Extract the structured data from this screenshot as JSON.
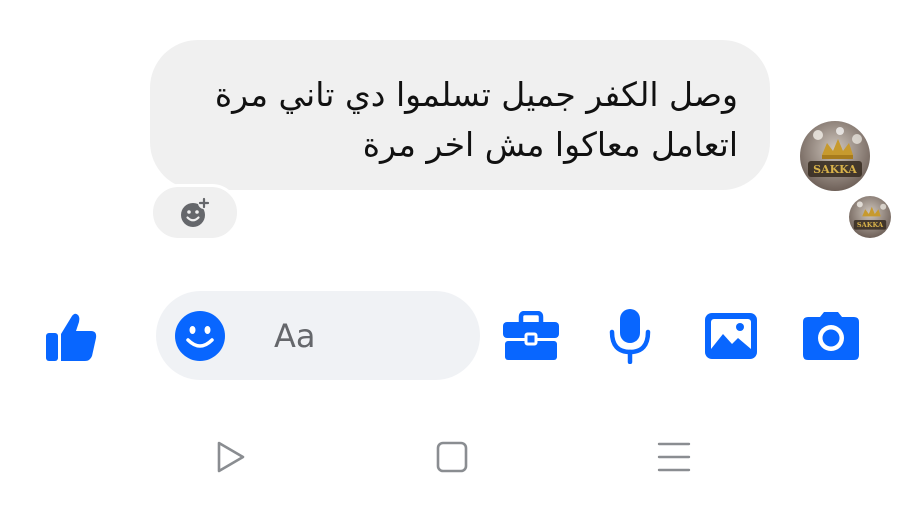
{
  "message": {
    "lines": [
      "وصل الكفر جميل تسلموا دي تاني مرة",
      "اتعامل معاكوا مش اخر مرة"
    ]
  },
  "composer": {
    "placeholder": "Aa"
  },
  "avatar": {
    "logo_text": "SAKKA"
  },
  "icons": {
    "like": "thumbs-up-icon",
    "emoji": "smiley-icon",
    "briefcase": "briefcase-icon",
    "mic": "microphone-icon",
    "image": "image-icon",
    "camera": "camera-icon",
    "reaction": "add-reaction-icon",
    "nav_back": "triangle-back-icon",
    "nav_home": "square-home-icon",
    "nav_recents": "menu-lines-icon"
  },
  "colors": {
    "accent": "#0866ff",
    "bubble_bg": "#f0f0f0",
    "input_bg": "#f0f2f5",
    "placeholder": "#65676b",
    "nav_icon": "#8a8d91"
  }
}
